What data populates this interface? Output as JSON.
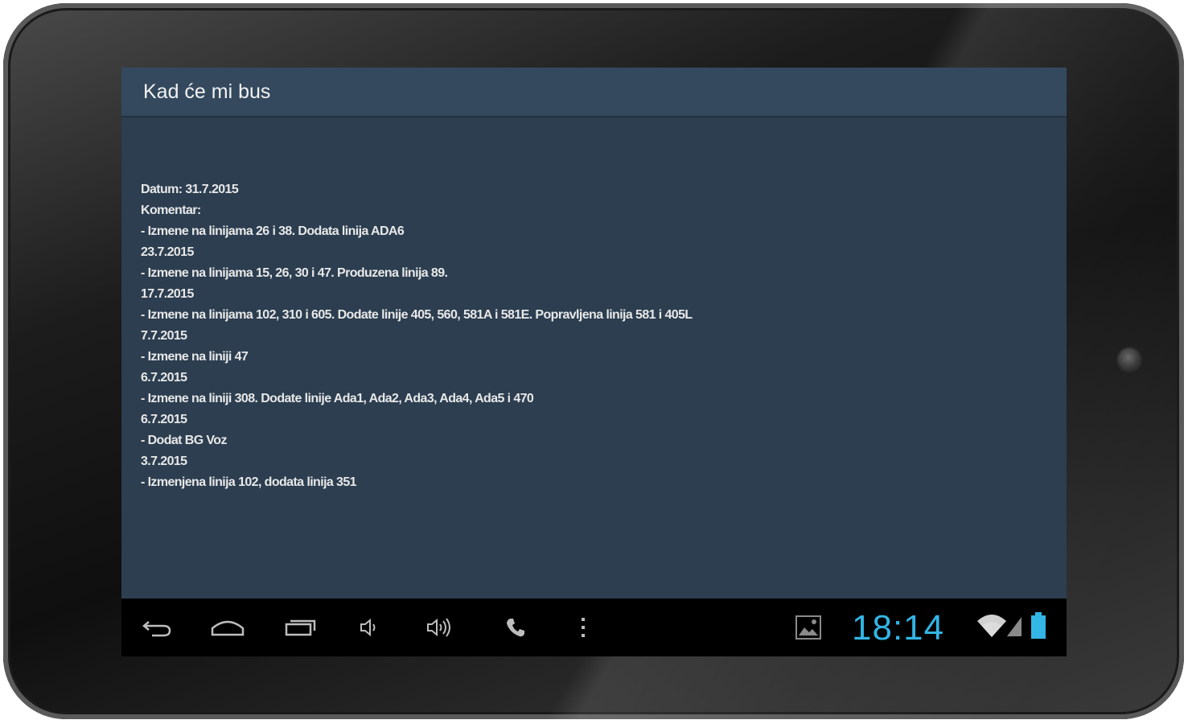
{
  "app": {
    "title": "Kad će mi bus"
  },
  "changelog": {
    "lines": [
      "Datum: 31.7.2015",
      "Komentar:",
      "- Izmene na linijama 26 i 38. Dodata linija ADA6",
      "23.7.2015",
      "- Izmene na linijama 15, 26, 30 i 47. Produzena linija 89.",
      "17.7.2015",
      "- Izmene na linijama 102, 310 i 605. Dodate linije 405, 560, 581A i 581E. Popravljena linija 581 i 405L",
      "7.7.2015",
      "- Izmene na liniji 47",
      "6.7.2015",
      "- Izmene na liniji 308. Dodate linije Ada1, Ada2, Ada3, Ada4, Ada5 i 470",
      "6.7.2015",
      "- Dodat BG Voz",
      "3.7.2015",
      "- Izmenjena linija 102, dodata linija 351"
    ]
  },
  "status_bar": {
    "time": "18:14",
    "accent_color": "#33b5e5"
  },
  "nav": {
    "icons": [
      "back-icon",
      "home-icon",
      "recent-apps-icon",
      "volume-down-icon",
      "volume-up-icon",
      "phone-icon",
      "menu-overflow-icon"
    ],
    "status_icons": [
      "gallery-notification-icon",
      "wifi-icon",
      "signal-icon",
      "battery-icon"
    ]
  },
  "colors": {
    "screen_bg": "#2c3e50",
    "action_bar_bg": "#34495e",
    "text": "#e8e8e8"
  }
}
